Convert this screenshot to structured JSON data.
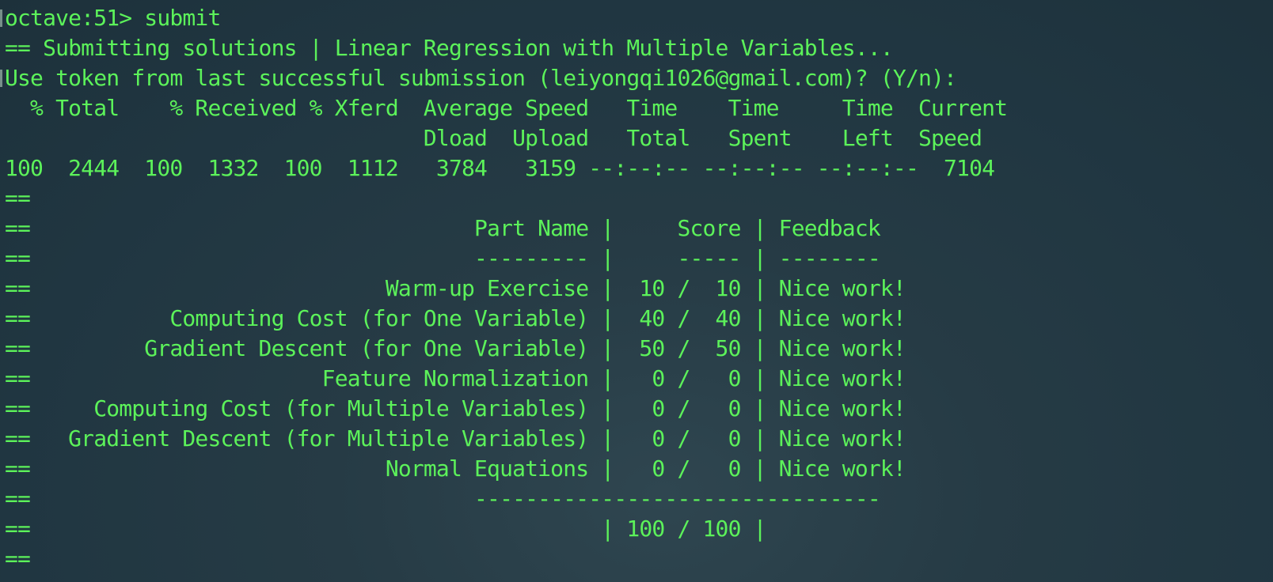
{
  "terminal": {
    "lines": [
      "octave:51> submit",
      "== Submitting solutions | Linear Regression with Multiple Variables...",
      "Use token from last successful submission (leiyongqi1026@gmail.com)? (Y/n):",
      "  % Total    % Received % Xferd  Average Speed   Time    Time     Time  Current",
      "                                 Dload  Upload   Total   Spent    Left  Speed",
      "100  2444  100  1332  100  1112   3784   3159 --:--:-- --:--:-- --:--:--  7104",
      "==",
      "==                                   Part Name |     Score | Feedback",
      "==                                   --------- |     ----- | --------",
      "==                            Warm-up Exercise |  10 /  10 | Nice work!",
      "==           Computing Cost (for One Variable) |  40 /  40 | Nice work!",
      "==         Gradient Descent (for One Variable) |  50 /  50 | Nice work!",
      "==                       Feature Normalization |   0 /   0 | Nice work!",
      "==     Computing Cost (for Multiple Variables) |   0 /   0 | Nice work!",
      "==   Gradient Descent (for Multiple Variables) |   0 /   0 | Nice work!",
      "==                            Normal Equations |   0 /   0 | Nice work!",
      "==                                   --------------------------------",
      "==                                             | 100 / 100 |",
      "=="
    ]
  }
}
